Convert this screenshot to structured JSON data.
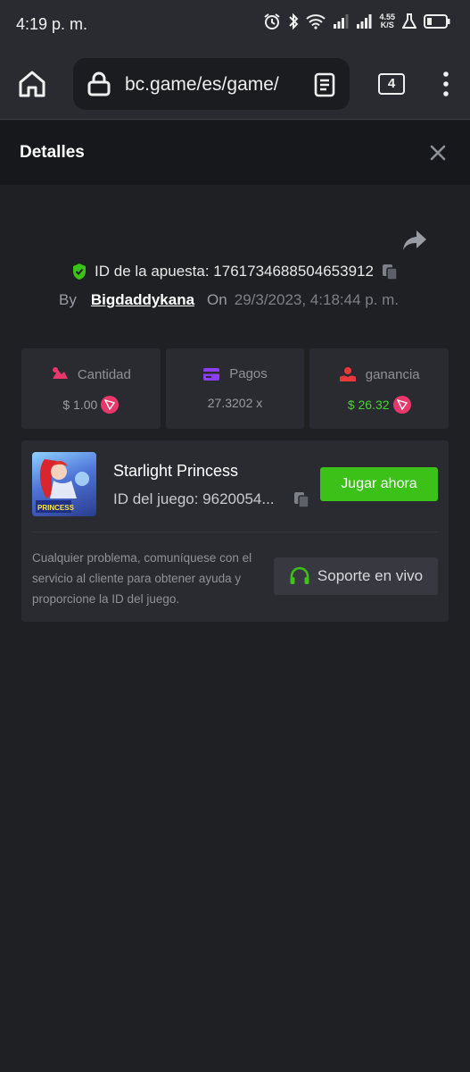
{
  "status_bar": {
    "time": "4:19 p. m.",
    "speed_value": "4.55",
    "speed_unit": "K/S"
  },
  "browser": {
    "url": "bc.game/es/game/",
    "tab_count": "4"
  },
  "header": {
    "title": "Detalles"
  },
  "bet": {
    "id_label": "ID de la apuesta: 1761734688504653912",
    "by_label": "By",
    "username": "Bigdaddykana",
    "on_label": "On",
    "date": "29/3/2023, 4:18:44 p. m."
  },
  "stats": [
    {
      "label": "Cantidad",
      "value": "$ 1.00",
      "icon": "amount-icon",
      "color": "#e8386b"
    },
    {
      "label": "Pagos",
      "value": "27.3202 x",
      "icon": "card-icon",
      "color": "#8b3ff0"
    },
    {
      "label": "ganancia",
      "value": "$ 26.32",
      "icon": "profit-icon",
      "color": "#e8383b"
    }
  ],
  "game": {
    "name": "Starlight Princess",
    "id_text": "ID del juego: 9620054...",
    "thumb_text": "PRINCESS",
    "play_label": "Jugar ahora",
    "help_text": "Cualquier problema, comuníquese con el servicio al cliente para obtener ayuda y proporcione la ID del juego.",
    "support_label": "Soporte en vivo"
  },
  "colors": {
    "accent_green": "#3bc117",
    "profit_green": "#44d62c",
    "coin_pink": "#e8386b",
    "panel": "#2a2b30",
    "background": "#1f2023"
  }
}
